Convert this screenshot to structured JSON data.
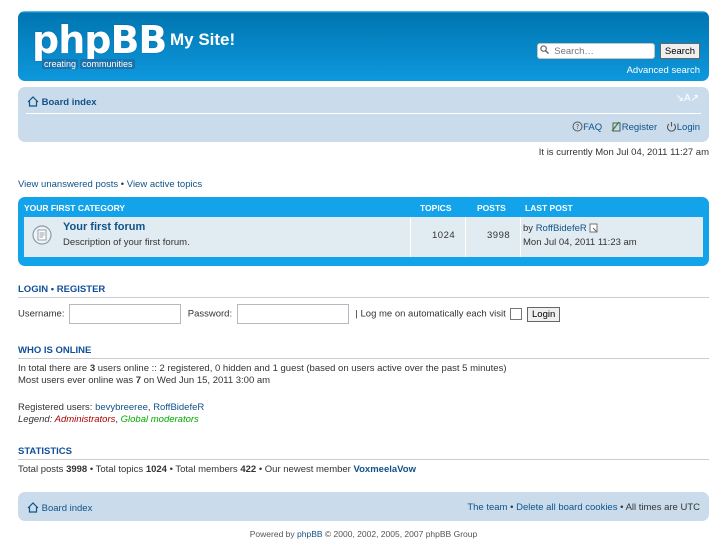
{
  "header": {
    "logo_text": "phpBB",
    "logo_tagline_1": "creating",
    "logo_tagline_2": "communities",
    "site_name": "My Site!",
    "search_placeholder": "Search…",
    "search_button": "Search",
    "advanced_search": "Advanced search"
  },
  "nav": {
    "breadcrumb": "Board index",
    "font_size_toggle": "↘A↗",
    "faq": "FAQ",
    "register": "Register",
    "login": "Login"
  },
  "time_info": "It is currently Mon Jul 04, 2011 11:27 am",
  "view_links": {
    "unanswered": "View unanswered posts",
    "sep": " • ",
    "active": "View active topics"
  },
  "forum_category": {
    "title": "Your first category",
    "col_topics": "Topics",
    "col_posts": "Posts",
    "col_lastpost": "Last post",
    "forums": [
      {
        "name": "Your first forum",
        "description": "Description of your first forum.",
        "topics": "1024",
        "posts": "3998",
        "last_by_prefix": "by ",
        "last_by": "RoffBidefeR",
        "last_time": "Mon Jul 04, 2011 11:23 am"
      }
    ]
  },
  "login_section": {
    "heading_login": "Login",
    "heading_sep": " • ",
    "heading_register": "Register",
    "username_label": "Username:",
    "password_label": "Password:",
    "auto_login_label": "| Log me on automatically each visit",
    "login_button": "Login"
  },
  "who_is_online": {
    "heading": "Who is online",
    "line1_a": "In total there are ",
    "line1_count": "3",
    "line1_b": " users online :: 2 registered, 0 hidden and 1 guest (based on users active over the past 5 minutes)",
    "line2_a": "Most users ever online was ",
    "line2_count": "7",
    "line2_b": " on Wed Jun 15, 2011 3:00 am",
    "registered_label": "Registered users: ",
    "registered_user_1": "bevybreeree",
    "registered_sep": ", ",
    "registered_user_2": "RoffBidefeR",
    "legend_label": "Legend: ",
    "legend_admins": "Administrators",
    "legend_sep": ", ",
    "legend_gmods": "Global moderators"
  },
  "statistics": {
    "heading": "Statistics",
    "posts_label": "Total posts ",
    "posts": "3998",
    "topics_label": " • Total topics ",
    "topics": "1024",
    "members_label": " • Total members ",
    "members": "422",
    "newest_label": " • Our newest member ",
    "newest": "VoxmeelaVow"
  },
  "footer": {
    "board_index": "Board index",
    "team": "The team",
    "sep": " • ",
    "delete_cookies": "Delete all board cookies",
    "times": " • All times are UTC"
  },
  "powered": {
    "prefix": "Powered by ",
    "link": "phpBB",
    "suffix": " © 2000, 2002, 2005, 2007 phpBB Group"
  },
  "colors": {
    "header_blue": "#12a3eb",
    "nav_bg": "#cadceb",
    "link": "#105289",
    "admin": "#aa0000",
    "global_mod": "#00aa00"
  }
}
